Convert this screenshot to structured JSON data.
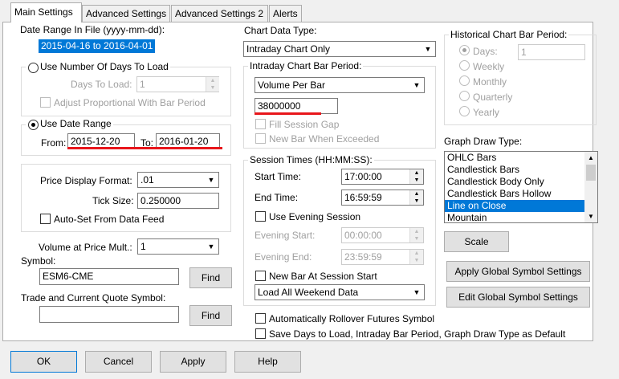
{
  "tabs": [
    {
      "label": "Main Settings",
      "active": true
    },
    {
      "label": "Advanced Settings",
      "active": false
    },
    {
      "label": "Advanced Settings 2",
      "active": false
    },
    {
      "label": "Alerts",
      "active": false
    }
  ],
  "date_range": {
    "label": "Date Range In File (yyyy-mm-dd):",
    "value": "2015-04-16 to 2016-04-01"
  },
  "days_group": {
    "radio_label": "Use Number Of Days To Load",
    "selected": false,
    "days_label": "Days To Load:",
    "days_value": "1",
    "adjust_label": "Adjust Proportional With Bar Period"
  },
  "date_group": {
    "radio_label": "Use Date Range",
    "selected": true,
    "from_label": "From:",
    "from_value": "2015-12-20",
    "to_label": "To:",
    "to_value": "2016-01-20"
  },
  "price_group": {
    "format_label": "Price Display Format:",
    "format_value": ".01",
    "tick_label": "Tick Size:",
    "tick_value": "0.250000",
    "autoset_label": "Auto-Set From Data Feed"
  },
  "volume_mult": {
    "label": "Volume at Price Mult.:",
    "value": "1"
  },
  "symbol": {
    "label": "Symbol:",
    "value": "ESM6-CME",
    "find_label": "Find"
  },
  "trade_symbol": {
    "label": "Trade and Current Quote Symbol:",
    "value": "",
    "find_label": "Find"
  },
  "chart_data_type": {
    "label": "Chart Data Type:",
    "value": "Intraday Chart Only"
  },
  "intraday_period": {
    "label": "Intraday Chart Bar Period:",
    "type_value": "Volume Per Bar",
    "amount_value": "38000000",
    "fill_gap_label": "Fill Session Gap",
    "new_bar_label": "New Bar When Exceeded"
  },
  "session_times": {
    "label": "Session Times (HH:MM:SS):",
    "start_label": "Start Time:",
    "start_value": "17:00:00",
    "end_label": "End Time:",
    "end_value": "16:59:59",
    "evening_label": "Use Evening Session",
    "evening_start_label": "Evening Start:",
    "evening_start_value": "00:00:00",
    "evening_end_label": "Evening End:",
    "evening_end_value": "23:59:59",
    "new_bar_session_label": "New Bar At Session Start",
    "weekend_value": "Load All Weekend Data"
  },
  "historical_period": {
    "label": "Historical Chart Bar Period:",
    "days_label": "Days:",
    "days_value": "1",
    "weekly_label": "Weekly",
    "monthly_label": "Monthly",
    "quarterly_label": "Quarterly",
    "yearly_label": "Yearly"
  },
  "graph_draw": {
    "label": "Graph Draw Type:",
    "items": [
      "OHLC Bars",
      "Candlestick Bars",
      "Candlestick Body Only",
      "Candlestick Bars Hollow",
      "Line on Close",
      "Mountain"
    ],
    "selected_index": 4
  },
  "scale_button": "Scale",
  "apply_global_button": "Apply Global Symbol Settings",
  "edit_global_button": "Edit Global Symbol Settings",
  "rollover_label": "Automatically Rollover Futures Symbol",
  "save_default_label": "Save Days to Load, Intraday Bar Period, Graph Draw Type as Default",
  "footer": {
    "ok": "OK",
    "cancel": "Cancel",
    "apply": "Apply",
    "help": "Help"
  },
  "colors": {
    "selection": "#0078d7",
    "annotation_red": "#e8161b"
  }
}
